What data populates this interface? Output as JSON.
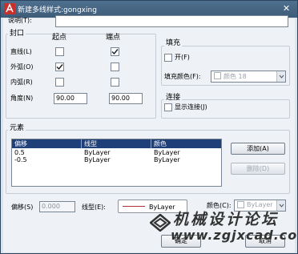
{
  "window": {
    "title": "新建多线样式:gongxing"
  },
  "description": {
    "label": "说明(T):",
    "value": ""
  },
  "caps": {
    "title": "封口",
    "col_start": "起点",
    "col_end": "端点",
    "rows": [
      {
        "label": "直线(L)",
        "start": false,
        "end": true
      },
      {
        "label": "外弧(O)",
        "start": true,
        "end": false
      },
      {
        "label": "内弧(R)",
        "start": false,
        "end": false
      }
    ],
    "angle_label": "角度(N)",
    "angle_start": "90.00",
    "angle_end": "90.00"
  },
  "fill": {
    "title": "填充",
    "on_label": "开(F)",
    "on_checked": false,
    "color_label": "填充颜色(F):",
    "color_value": "颜色 18",
    "color_checked": false
  },
  "connect": {
    "title": "连接",
    "show_label": "显示连接(J)",
    "show_checked": false
  },
  "elements": {
    "title": "元素",
    "headers": [
      "偏移",
      "线型",
      "颜色"
    ],
    "rows": [
      {
        "offset": "0.5",
        "linetype": "ByLayer",
        "color": "ByLayer"
      },
      {
        "offset": "-0.5",
        "linetype": "ByLayer",
        "color": "ByLayer"
      }
    ],
    "add_label": "添加(A)",
    "delete_label": "删除(D)"
  },
  "bottom": {
    "offset_label": "偏移(S)",
    "offset_value": "0.000",
    "linetype_label": "线型(E):",
    "linetype_value": "ByLayer",
    "linetype_color": "#b0303a",
    "color_label": "颜色(C):",
    "color_value": "ByLayer",
    "ok_label": "确定",
    "cancel_label": "取消"
  },
  "watermark": {
    "text_cn": "机械设计论坛",
    "text_url": "www.zgjxcad.com",
    "color": "#333333"
  },
  "colors": {
    "titlebar": "#46678a",
    "list_header": "#1f3f78",
    "list_header_text": "#ffffff"
  }
}
